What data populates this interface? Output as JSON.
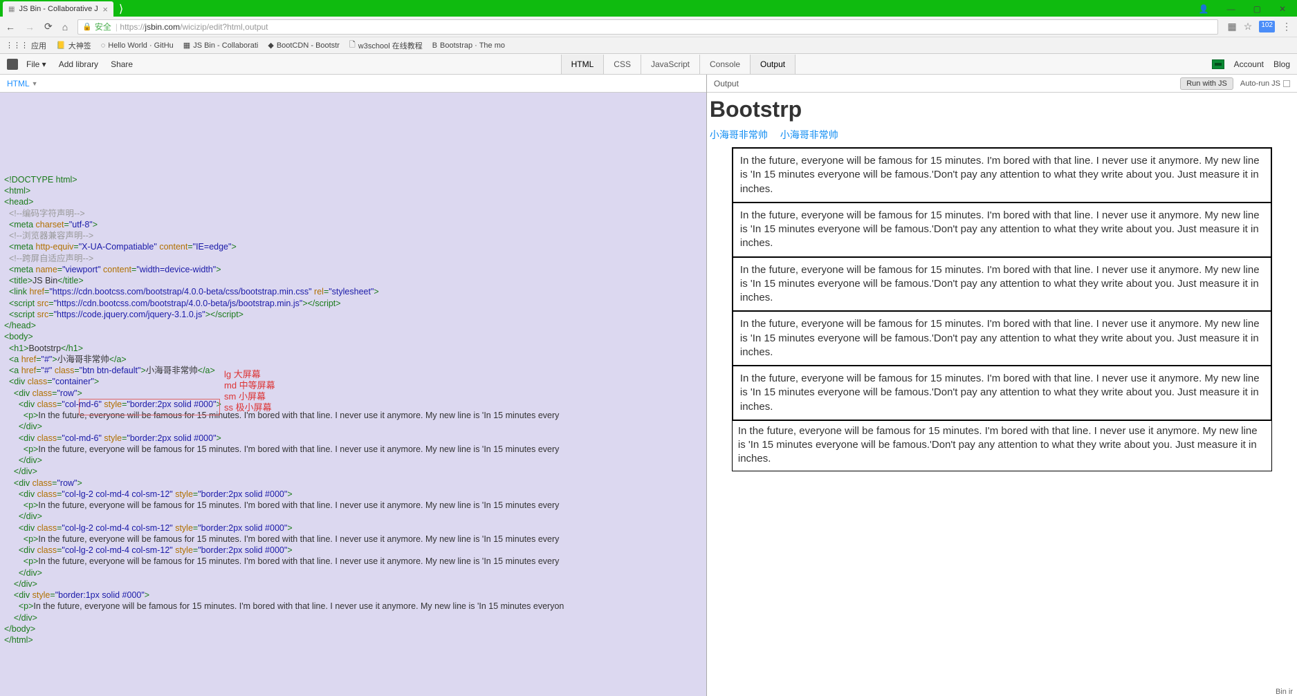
{
  "browser": {
    "tab_title": "JS Bin - Collaborative J",
    "win_min": "—",
    "win_max": "▢",
    "win_close": "✕",
    "user_icon": "👤",
    "nav": {
      "back": "←",
      "forward": "→",
      "reload": "⟳",
      "home": "⌂"
    },
    "lock": "🔒",
    "safe_label": "安全",
    "url_prefix": "https://",
    "url_main": "jsbin.com",
    "url_suffix": "/wicizip/edit?html,output",
    "addr_icons": {
      "ext": "▦",
      "star": "☆",
      "menu": "⋮",
      "badge": "102"
    },
    "bookmarks": [
      {
        "icon": "⋮⋮⋮",
        "label": "应用"
      },
      {
        "icon": "📒",
        "label": "大神签"
      },
      {
        "icon": "◌",
        "label": "Hello World · GitHu"
      },
      {
        "icon": "▦",
        "label": "JS Bin - Collaborati"
      },
      {
        "icon": "◆",
        "label": "BootCDN - Bootstr"
      },
      {
        "icon": "🗋",
        "label": "w3school 在线教程"
      },
      {
        "icon": "B",
        "label": "Bootstrap · The mo"
      }
    ]
  },
  "jsbin": {
    "file": "File ▾",
    "addlib": "Add library",
    "share": "Share",
    "tabs": [
      "HTML",
      "CSS",
      "JavaScript",
      "Console",
      "Output"
    ],
    "active_tabs": [
      0,
      4
    ],
    "account": "Account",
    "blog": "Blog",
    "left_header": "HTML",
    "right_header": "Output",
    "run_label": "Run with JS",
    "autorun_label": "Auto-run JS",
    "footer": "Bin ir"
  },
  "code": {
    "lines": [
      [
        [
          "tag",
          "<!DOCTYPE html>"
        ]
      ],
      [
        [
          "tag",
          "<html>"
        ]
      ],
      [
        [
          "txt",
          ""
        ]
      ],
      [
        [
          "tag",
          "<head>"
        ]
      ],
      [
        [
          "txt",
          "  "
        ],
        [
          "cmt",
          "<!--编码字符声明-->"
        ]
      ],
      [
        [
          "txt",
          "  "
        ],
        [
          "tag",
          "<meta "
        ],
        [
          "attr",
          "charset"
        ],
        [
          "tag",
          "="
        ],
        [
          "str",
          "\"utf-8\""
        ],
        [
          "tag",
          ">"
        ]
      ],
      [
        [
          "txt",
          "  "
        ],
        [
          "cmt",
          "<!--浏览器兼容声明-->"
        ]
      ],
      [
        [
          "txt",
          "  "
        ],
        [
          "tag",
          "<meta "
        ],
        [
          "attr",
          "http-equiv"
        ],
        [
          "tag",
          "="
        ],
        [
          "str",
          "\"X-UA-Compatiable\""
        ],
        [
          "tag",
          " "
        ],
        [
          "attr",
          "content"
        ],
        [
          "tag",
          "="
        ],
        [
          "str",
          "\"IE=edge\""
        ],
        [
          "tag",
          ">"
        ]
      ],
      [
        [
          "txt",
          "  "
        ],
        [
          "cmt",
          "<!--跨屏自适应声明-->"
        ]
      ],
      [
        [
          "txt",
          "  "
        ],
        [
          "tag",
          "<meta "
        ],
        [
          "attr",
          "name"
        ],
        [
          "tag",
          "="
        ],
        [
          "str",
          "\"viewport\""
        ],
        [
          "tag",
          " "
        ],
        [
          "attr",
          "content"
        ],
        [
          "tag",
          "="
        ],
        [
          "str",
          "\"width=device-width\""
        ],
        [
          "tag",
          ">"
        ]
      ],
      [
        [
          "txt",
          "  "
        ],
        [
          "tag",
          "<title>"
        ],
        [
          "txt",
          "JS Bin"
        ],
        [
          "tag",
          "</title>"
        ]
      ],
      [
        [
          "txt",
          "  "
        ],
        [
          "tag",
          "<link "
        ],
        [
          "attr",
          "href"
        ],
        [
          "tag",
          "="
        ],
        [
          "str",
          "\"https://cdn.bootcss.com/bootstrap/4.0.0-beta/css/bootstrap.min.css\""
        ],
        [
          "tag",
          " "
        ],
        [
          "attr",
          "rel"
        ],
        [
          "tag",
          "="
        ],
        [
          "str",
          "\"stylesheet\""
        ],
        [
          "tag",
          ">"
        ]
      ],
      [
        [
          "txt",
          "  "
        ],
        [
          "tag",
          "<script "
        ],
        [
          "attr",
          "src"
        ],
        [
          "tag",
          "="
        ],
        [
          "str",
          "\"https://cdn.bootcss.com/bootstrap/4.0.0-beta/js/bootstrap.min.js\""
        ],
        [
          "tag",
          "></script>"
        ]
      ],
      [
        [
          "txt",
          "  "
        ],
        [
          "tag",
          "<script "
        ],
        [
          "attr",
          "src"
        ],
        [
          "tag",
          "="
        ],
        [
          "str",
          "\"https://code.jquery.com/jquery-3.1.0.js\""
        ],
        [
          "tag",
          "></script>"
        ]
      ],
      [
        [
          "tag",
          "</head>"
        ]
      ],
      [
        [
          "txt",
          ""
        ]
      ],
      [
        [
          "tag",
          "<body>"
        ]
      ],
      [
        [
          "txt",
          "  "
        ],
        [
          "tag",
          "<h1>"
        ],
        [
          "txt",
          "Bootstrp"
        ],
        [
          "tag",
          "</h1>"
        ]
      ],
      [
        [
          "txt",
          "  "
        ],
        [
          "tag",
          "<a "
        ],
        [
          "attr",
          "href"
        ],
        [
          "tag",
          "="
        ],
        [
          "str",
          "\"#\""
        ],
        [
          "tag",
          ">"
        ],
        [
          "txt",
          "小海哥非常帅"
        ],
        [
          "tag",
          "</a>"
        ]
      ],
      [
        [
          "txt",
          "  "
        ],
        [
          "tag",
          "<a "
        ],
        [
          "attr",
          "href"
        ],
        [
          "tag",
          "="
        ],
        [
          "str",
          "\"#\""
        ],
        [
          "tag",
          " "
        ],
        [
          "attr",
          "class"
        ],
        [
          "tag",
          "="
        ],
        [
          "str",
          "\"btn btn-default\""
        ],
        [
          "tag",
          ">"
        ],
        [
          "txt",
          "小海哥非常帅"
        ],
        [
          "tag",
          "</a>"
        ]
      ],
      [
        [
          "txt",
          "  "
        ],
        [
          "tag",
          "<div "
        ],
        [
          "attr",
          "class"
        ],
        [
          "tag",
          "="
        ],
        [
          "str",
          "\"container\""
        ],
        [
          "tag",
          ">"
        ]
      ],
      [
        [
          "txt",
          "    "
        ],
        [
          "tag",
          "<div "
        ],
        [
          "attr",
          "class"
        ],
        [
          "tag",
          "="
        ],
        [
          "str",
          "\"row\""
        ],
        [
          "tag",
          ">"
        ]
      ],
      [
        [
          "txt",
          "      "
        ],
        [
          "tag",
          "<div "
        ],
        [
          "attr",
          "class"
        ],
        [
          "tag",
          "="
        ],
        [
          "str",
          "\"col-md-6\""
        ],
        [
          "tag",
          " "
        ],
        [
          "attr",
          "style"
        ],
        [
          "tag",
          "="
        ],
        [
          "str",
          "\"border:2px solid #000\""
        ],
        [
          "tag",
          ">"
        ]
      ],
      [
        [
          "txt",
          "        "
        ],
        [
          "tag",
          "<p>"
        ],
        [
          "txt",
          "In the future, everyone will be famous for 15 minutes. I'm bored with that line. I never use it anymore. My new line is 'In 15 minutes every"
        ]
      ],
      [
        [
          "txt",
          "      "
        ],
        [
          "tag",
          "</div>"
        ]
      ],
      [
        [
          "txt",
          "      "
        ],
        [
          "tag",
          "<div "
        ],
        [
          "attr",
          "class"
        ],
        [
          "tag",
          "="
        ],
        [
          "str",
          "\"col-md-6\""
        ],
        [
          "tag",
          " "
        ],
        [
          "attr",
          "style"
        ],
        [
          "tag",
          "="
        ],
        [
          "str",
          "\"border:2px solid #000\""
        ],
        [
          "tag",
          ">"
        ]
      ],
      [
        [
          "txt",
          "        "
        ],
        [
          "tag",
          "<p>"
        ],
        [
          "txt",
          "In the future, everyone will be famous for 15 minutes. I'm bored with that line. I never use it anymore. My new line is 'In 15 minutes every"
        ]
      ],
      [
        [
          "txt",
          "      "
        ],
        [
          "tag",
          "</div>"
        ]
      ],
      [
        [
          "txt",
          "    "
        ],
        [
          "tag",
          "</div>"
        ]
      ],
      [
        [
          "txt",
          ""
        ]
      ],
      [
        [
          "txt",
          "    "
        ],
        [
          "tag",
          "<div "
        ],
        [
          "attr",
          "class"
        ],
        [
          "tag",
          "="
        ],
        [
          "str",
          "\"row\""
        ],
        [
          "tag",
          ">"
        ]
      ],
      [
        [
          "txt",
          "      "
        ],
        [
          "tag",
          "<div "
        ],
        [
          "attr",
          "class"
        ],
        [
          "tag",
          "="
        ],
        [
          "str",
          "\"col-lg-2 col-md-4 col-sm-12\""
        ],
        [
          "tag",
          " "
        ],
        [
          "attr",
          "style"
        ],
        [
          "tag",
          "="
        ],
        [
          "str",
          "\"border:2px solid #000\""
        ],
        [
          "tag",
          ">"
        ]
      ],
      [
        [
          "txt",
          "        "
        ],
        [
          "tag",
          "<p>"
        ],
        [
          "txt",
          "In the future, everyone will be famous for 15 minutes. I'm bored with that line. I never use it anymore. My new line is 'In 15 minutes every"
        ]
      ],
      [
        [
          "txt",
          "      "
        ],
        [
          "tag",
          "</div>"
        ]
      ],
      [
        [
          "txt",
          "      "
        ],
        [
          "tag",
          "<div "
        ],
        [
          "attr",
          "class"
        ],
        [
          "tag",
          "="
        ],
        [
          "str",
          "\"col-lg-2 col-md-4 col-sm-12\""
        ],
        [
          "tag",
          " "
        ],
        [
          "attr",
          "style"
        ],
        [
          "tag",
          "="
        ],
        [
          "str",
          "\"border:2px solid #000\""
        ],
        [
          "tag",
          ">"
        ]
      ],
      [
        [
          "txt",
          "        "
        ],
        [
          "tag",
          "<p>"
        ],
        [
          "txt",
          "In the future, everyone will be famous for 15 minutes. I'm bored with that line. I never use it anymore. My new line is 'In 15 minutes every"
        ]
      ],
      [
        [
          "txt",
          "      "
        ],
        [
          "tag",
          "<div "
        ],
        [
          "attr",
          "class"
        ],
        [
          "tag",
          "="
        ],
        [
          "str",
          "\"col-lg-2 col-md-4 col-sm-12\""
        ],
        [
          "tag",
          " "
        ],
        [
          "attr",
          "style"
        ],
        [
          "tag",
          "="
        ],
        [
          "str",
          "\"border:2px solid #000\""
        ],
        [
          "tag",
          ">"
        ]
      ],
      [
        [
          "txt",
          "        "
        ],
        [
          "tag",
          "<p>"
        ],
        [
          "txt",
          "In the future, everyone will be famous for 15 minutes. I'm bored with that line. I never use it anymore. My new line is 'In 15 minutes every"
        ]
      ],
      [
        [
          "txt",
          "      "
        ],
        [
          "tag",
          "</div>"
        ]
      ],
      [
        [
          "txt",
          "    "
        ],
        [
          "tag",
          "</div>"
        ]
      ],
      [
        [
          "txt",
          "    "
        ],
        [
          "tag",
          "<div "
        ],
        [
          "attr",
          "style"
        ],
        [
          "tag",
          "="
        ],
        [
          "str",
          "\"border:1px solid #000\""
        ],
        [
          "tag",
          ">"
        ]
      ],
      [
        [
          "txt",
          "      "
        ],
        [
          "tag",
          "<p>"
        ],
        [
          "txt",
          "In the future, everyone will be famous for 15 minutes. I'm bored with that line. I never use it anymore. My new line is 'In 15 minutes everyon"
        ]
      ],
      [
        [
          "txt",
          "    "
        ],
        [
          "tag",
          "</div>"
        ]
      ],
      [
        [
          "tag",
          "</body>"
        ]
      ],
      [
        [
          "txt",
          ""
        ]
      ],
      [
        [
          "tag",
          "</html>"
        ]
      ]
    ],
    "annotations": {
      "lg": "lg 大屏幕",
      "md": "md 中等屏幕",
      "sm": "sm 小屏幕",
      "ss": "ss 极小屏幕"
    }
  },
  "output": {
    "heading": "Bootstrp",
    "link1": "小海哥非常帅",
    "link2": "小海哥非常帅",
    "paragraph": "In the future, everyone will be famous for 15 minutes. I'm bored with that line. I never use it anymore. My new line is 'In 15 minutes everyone will be famous.'Don't pay any attention to what they write about you. Just measure it in inches."
  }
}
